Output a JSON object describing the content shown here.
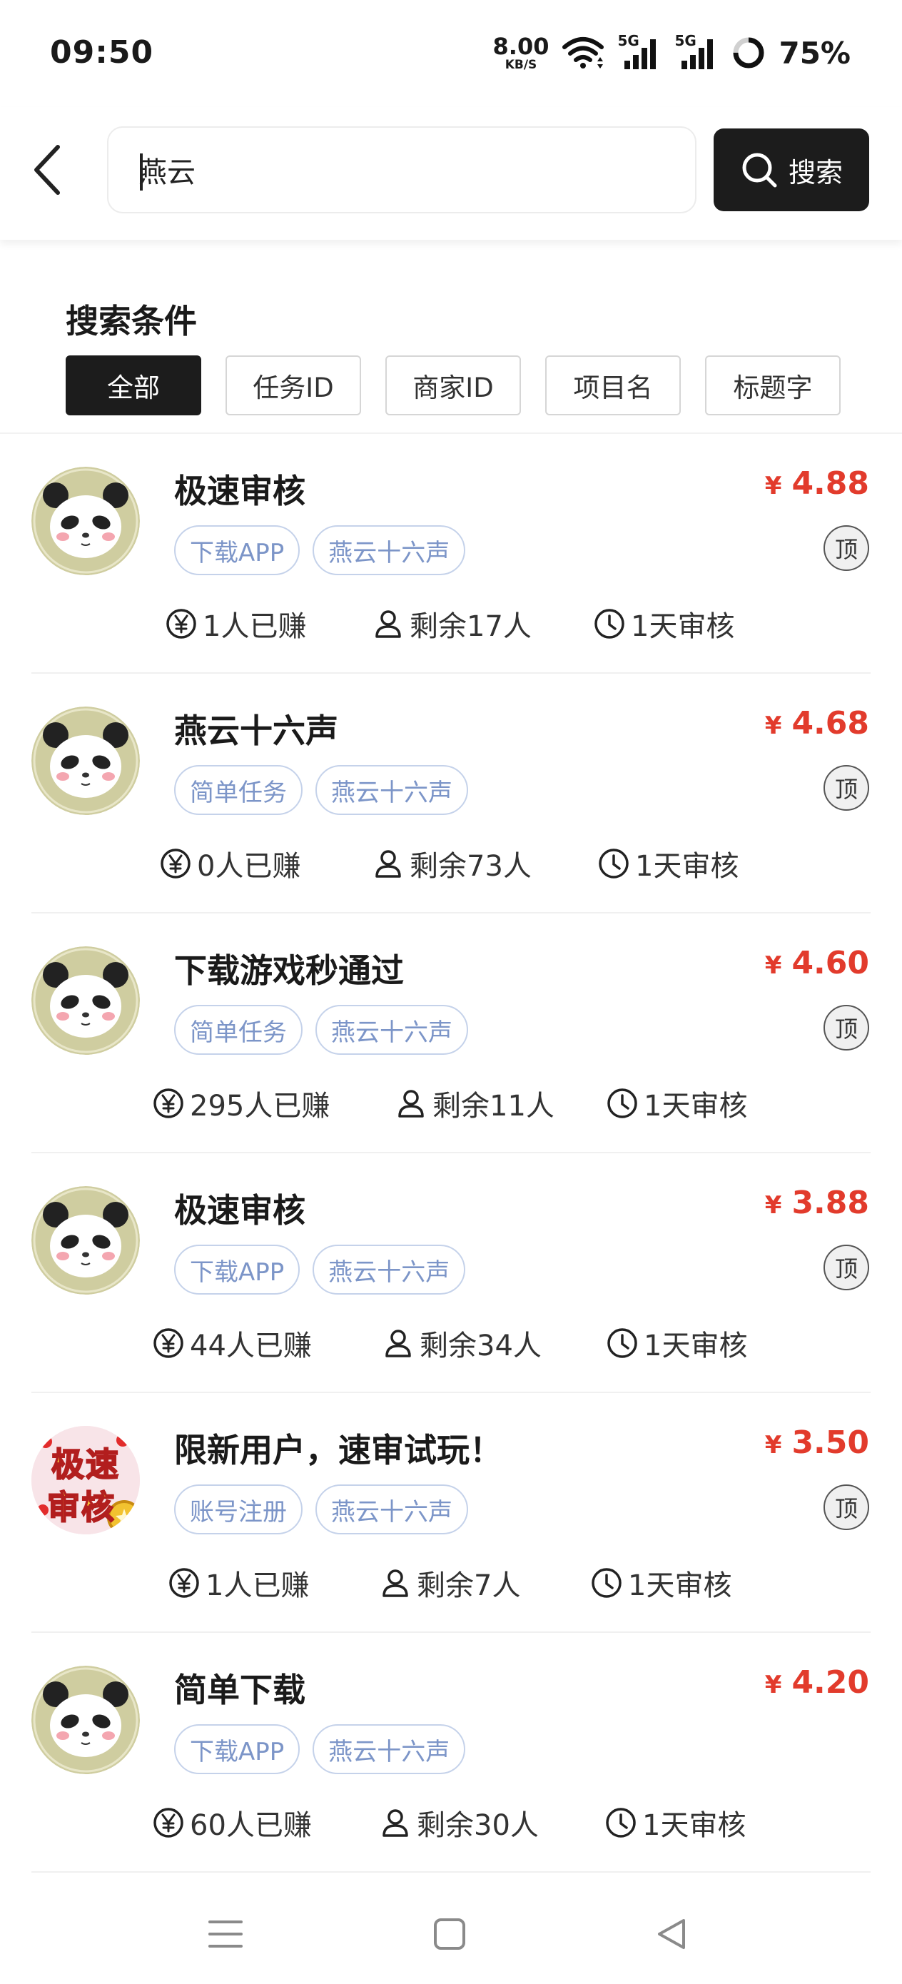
{
  "status_bar": {
    "time": "09:50",
    "net_speed_value": "8.00",
    "net_speed_unit": "KB/S",
    "signal1_label": "5G",
    "signal2_label": "5G",
    "battery": "75%"
  },
  "header": {
    "back_icon": "chevron-left-icon",
    "search_value": "燕云",
    "search_button": "搜索"
  },
  "conditions": {
    "title": "搜索条件",
    "chips": [
      {
        "label": "全部",
        "active": true
      },
      {
        "label": "任务ID",
        "active": false
      },
      {
        "label": "商家ID",
        "active": false
      },
      {
        "label": "项目名",
        "active": false
      },
      {
        "label": "标题字",
        "active": false
      }
    ]
  },
  "currency_symbol": "¥",
  "top_label": "顶",
  "tasks": [
    {
      "title": "极速审核",
      "price": "4.88",
      "tags": [
        "下载APP",
        "燕云十六声"
      ],
      "earned": "1人已赚",
      "remaining": "剩余17人",
      "review": "1天审核",
      "avatar": "panda"
    },
    {
      "title": "燕云十六声",
      "price": "4.68",
      "tags": [
        "简单任务",
        "燕云十六声"
      ],
      "earned": "0人已赚",
      "remaining": "剩余73人",
      "review": "1天审核",
      "avatar": "panda"
    },
    {
      "title": "下载游戏秒通过",
      "price": "4.60",
      "tags": [
        "简单任务",
        "燕云十六声"
      ],
      "earned": "295人已赚",
      "remaining": "剩余11人",
      "review": "1天审核",
      "avatar": "panda"
    },
    {
      "title": "极速审核",
      "price": "3.88",
      "tags": [
        "下载APP",
        "燕云十六声"
      ],
      "earned": "44人已赚",
      "remaining": "剩余34人",
      "review": "1天审核",
      "avatar": "panda"
    },
    {
      "title": "限新用户，速审试玩！",
      "price": "3.50",
      "tags": [
        "账号注册",
        "燕云十六声"
      ],
      "earned": "1人已赚",
      "remaining": "剩余7人",
      "review": "1天审核",
      "avatar": "fast-review",
      "avatar_text": [
        "极速",
        "审核"
      ]
    },
    {
      "title": "简单下载",
      "price": "4.20",
      "tags": [
        "下载APP",
        "燕云十六声"
      ],
      "earned": "60人已赚",
      "remaining": "剩余30人",
      "review": "1天审核",
      "avatar": "panda"
    }
  ],
  "colors": {
    "price": "#e23b2c",
    "tag_text": "#7c95c8",
    "tag_border": "#c5d2ea",
    "dark": "#1c1c1c"
  },
  "nav": {
    "menu_icon": "menu-icon",
    "home_icon": "home-square-icon",
    "back_icon": "back-triangle-icon"
  }
}
